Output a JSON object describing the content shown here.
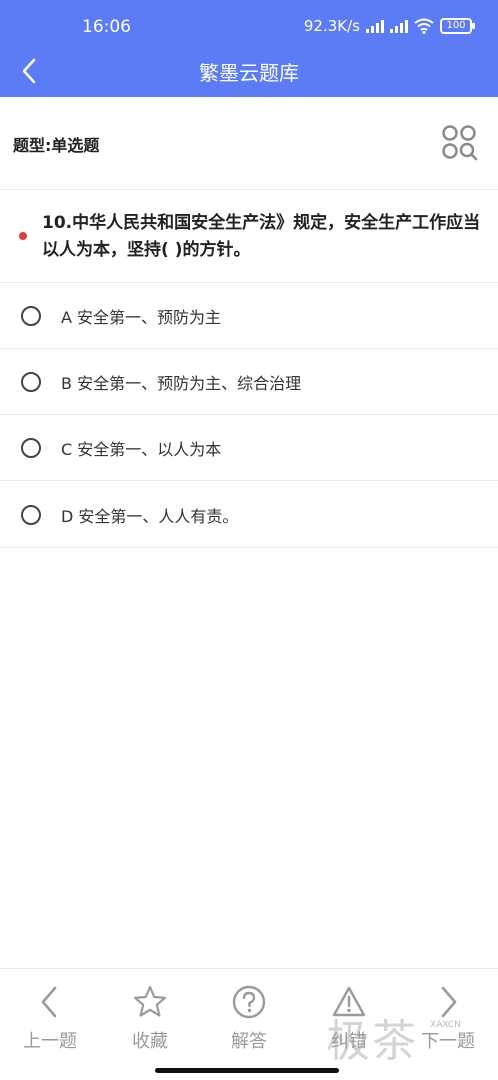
{
  "status_bar": {
    "time": "16:06",
    "network_speed": "92.3K/s",
    "battery": "100"
  },
  "header": {
    "title": "繁墨云题库"
  },
  "question_type": "题型:单选题",
  "question": {
    "text": "10.中华人民共和国安全生产法》规定，安全生产工作应当以人为本，坚持( )的方针。"
  },
  "options": [
    {
      "label": "A 安全第一、预防为主"
    },
    {
      "label": "B 安全第一、预防为主、综合治理"
    },
    {
      "label": "C 安全第一、以人为本"
    },
    {
      "label": "D 安全第一、人人有责。"
    }
  ],
  "bottom_nav": {
    "prev": "上一题",
    "favorite": "收藏",
    "answer": "解答",
    "report_error": "纠错",
    "next": "下一题"
  },
  "watermark": {
    "text": "极茶",
    "small": "XAXCN"
  },
  "colors": {
    "header": "#5b7cf5",
    "accent_dot": "#e4393c",
    "nav_gray": "#9a9a9a"
  },
  "icons": {
    "back": "chevron-left-icon",
    "answer_card": "four-circles-search-icon",
    "prev": "chevron-left-icon",
    "favorite": "star-icon",
    "answer": "question-circle-icon",
    "report_error": "warning-triangle-icon",
    "next": "chevron-right-icon"
  }
}
